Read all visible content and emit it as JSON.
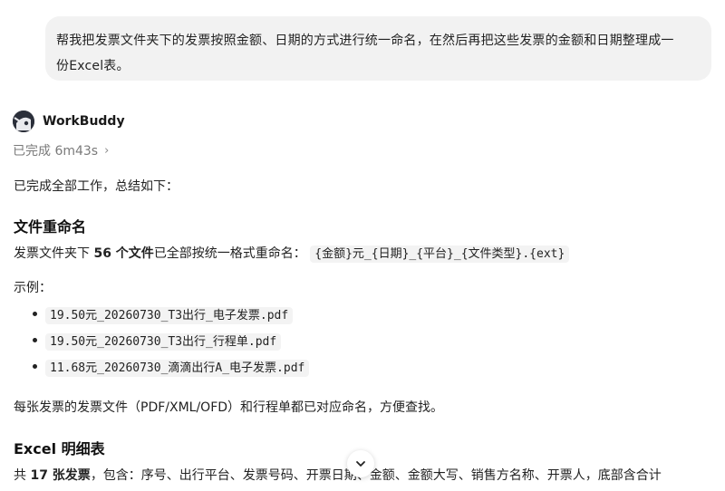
{
  "user_message": {
    "line1": "帮我把发票文件夹下的发票按照金额、日期的方式进行统一命名，在然后再把这些发票的金额和日期整理成一",
    "line2": "份Excel表。"
  },
  "agent": {
    "name": "WorkBuddy",
    "avatar_icon": "robot-avatar-icon",
    "status": "已完成 6m43s",
    "status_chevron": "›"
  },
  "response": {
    "intro": "已完成全部工作，总结如下：",
    "section1": {
      "heading": "文件重命名",
      "sentence_prefix": "发票文件夹下 ",
      "sentence_bold": "56 个文件",
      "sentence_middle": "已全部按统一格式重命名：",
      "format_code": "{金额}元_{日期}_{平台}_{文件类型}.{ext}",
      "examples_label": "示例：",
      "examples": [
        "19.50元_20260730_T3出行_电子发票.pdf",
        "19.50元_20260730_T3出行_行程单.pdf",
        "11.68元_20260730_滴滴出行A_电子发票.pdf"
      ],
      "note": "每张发票的发票文件（PDF/XML/OFD）和行程单都已对应命名，方便查找。"
    },
    "section2": {
      "heading": "Excel 明细表",
      "sentence_prefix": "共 ",
      "sentence_bold": "17 张发票",
      "sentence_rest": "，包含：序号、出行平台、发票号码、开票日期、金额、金额大写、销售方名称、开票人，底部含合计"
    }
  },
  "colors": {
    "user_bubble_bg": "#f2f2f2",
    "code_bg": "#f3f3f3",
    "status_text": "#7a7a7a"
  },
  "scroll_button_icon": "chevron-down-icon"
}
